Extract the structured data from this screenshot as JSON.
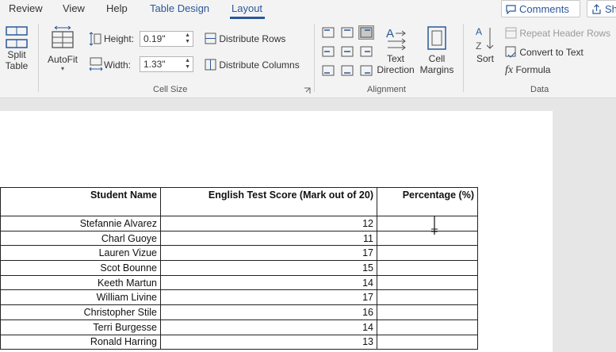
{
  "tabs": [
    "Review",
    "View",
    "Help",
    "Table Design",
    "Layout"
  ],
  "active_tab": "Layout",
  "comments_label": "Comments",
  "share_label": "Sh",
  "ribbon": {
    "split_table": [
      "Split",
      "Table"
    ],
    "autofit": "AutoFit",
    "height_label": "Height:",
    "height_value": "0.19\"",
    "width_label": "Width:",
    "width_value": "1.33\"",
    "distribute_rows": "Distribute Rows",
    "distribute_columns": "Distribute Columns",
    "cell_size_group": "Cell Size",
    "text_direction": [
      "Text",
      "Direction"
    ],
    "cell_margins": [
      "Cell",
      "Margins"
    ],
    "alignment_group": "Alignment",
    "sort": "Sort",
    "repeat_header_rows": "Repeat Header Rows",
    "convert_to_text": "Convert to Text",
    "formula": "Formula",
    "data_group": "Data"
  },
  "table": {
    "headers": [
      "Student Name",
      "English Test Score (Mark out of 20)",
      "Percentage (%)"
    ],
    "rows": [
      [
        "Stefannie Alvarez",
        "12",
        ""
      ],
      [
        "Charl Guoye",
        "11",
        ""
      ],
      [
        "Lauren Vizue",
        "17",
        ""
      ],
      [
        "Scot Bounne",
        "15",
        ""
      ],
      [
        "Keeth Martun",
        "14",
        ""
      ],
      [
        "William Livine",
        "17",
        ""
      ],
      [
        "Christopher Stile",
        "16",
        ""
      ],
      [
        "Terri Burgesse",
        "14",
        ""
      ],
      [
        "Ronald Harring",
        "13",
        ""
      ]
    ]
  },
  "colors": {
    "accent": "#2b579a",
    "ribbon_bg": "#f3f3f3",
    "doc_bg": "#e6e6e6"
  }
}
